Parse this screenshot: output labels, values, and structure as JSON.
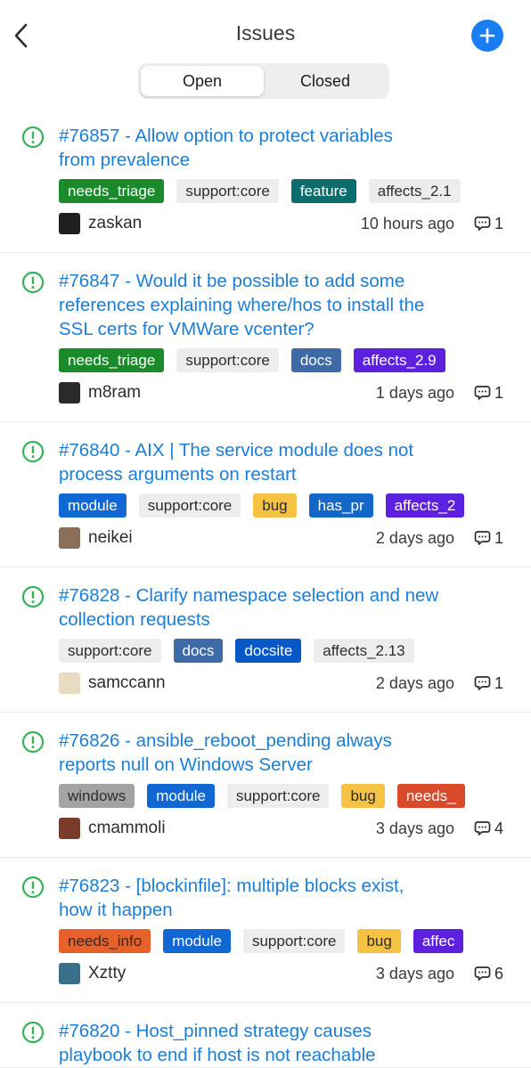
{
  "header": {
    "title": "Issues",
    "back_icon": "chevron-left-icon",
    "add_icon": "plus-icon"
  },
  "segment": {
    "open": "Open",
    "closed": "Closed",
    "selected": "Open"
  },
  "colors": {
    "accent": "#1a7ef2",
    "link": "#1b7ed6",
    "open_icon": "#35b359",
    "label_needs_triage": "#1a8a2b",
    "label_support_core": "#ededed",
    "label_feature": "#0c6d6e",
    "label_affects": "#ebebeb",
    "label_docs": "#3c6ba6",
    "label_affects_purple": "#5d20de",
    "label_module": "#1168d3",
    "label_bug": "#f6c244",
    "label_has_pr": "#1368c7",
    "label_docsite": "#0758c6",
    "label_windows": "#a3a3a3",
    "label_needs_info": "#e6622a"
  },
  "issues": [
    {
      "title_line1": "#76857 - Allow option to protect variables",
      "title_line2": "from prevalence",
      "title_line3": "",
      "labels": [
        {
          "text": "needs_triage",
          "bg": "#1a8a2b",
          "fg": "#ffffff"
        },
        {
          "text": "support:core",
          "bg": "#ededed",
          "fg": "#2c2c2e"
        },
        {
          "text": "feature",
          "bg": "#0c6d6e",
          "fg": "#ffffff"
        },
        {
          "text": "affects_2.1",
          "bg": "#ededed",
          "fg": "#2c2c2e"
        }
      ],
      "user": "zaskan",
      "time": "10 hours ago",
      "comments": "1"
    },
    {
      "title_line1": "#76847 - Would it be possible to add some",
      "title_line2": "references explaining where/hos to install the",
      "title_line3": "SSL certs for VMWare vcenter?",
      "labels": [
        {
          "text": "needs_triage",
          "bg": "#1a8a2b",
          "fg": "#ffffff"
        },
        {
          "text": "support:core",
          "bg": "#ededed",
          "fg": "#2c2c2e"
        },
        {
          "text": "docs",
          "bg": "#3c6ba6",
          "fg": "#ffffff"
        },
        {
          "text": "affects_2.9",
          "bg": "#5d20de",
          "fg": "#ffffff"
        }
      ],
      "user": "m8ram",
      "time": "1 days ago",
      "comments": "1"
    },
    {
      "title_line1": "#76840 - AIX | The service module does not",
      "title_line2": "process arguments on restart",
      "title_line3": "",
      "labels": [
        {
          "text": "module",
          "bg": "#1168d3",
          "fg": "#ffffff"
        },
        {
          "text": "support:core",
          "bg": "#ededed",
          "fg": "#2c2c2e"
        },
        {
          "text": "bug",
          "bg": "#f6c244",
          "fg": "#2c2c2e"
        },
        {
          "text": "has_pr",
          "bg": "#1368c7",
          "fg": "#ffffff"
        },
        {
          "text": "affects_2",
          "bg": "#5d20de",
          "fg": "#ffffff"
        }
      ],
      "user": "neikei",
      "time": "2 days ago",
      "comments": "1"
    },
    {
      "title_line1": "#76828 - Clarify namespace selection and new",
      "title_line2": "collection requests",
      "title_line3": "",
      "labels": [
        {
          "text": "support:core",
          "bg": "#ededed",
          "fg": "#2c2c2e"
        },
        {
          "text": "docs",
          "bg": "#3c6ba6",
          "fg": "#ffffff"
        },
        {
          "text": "docsite",
          "bg": "#0758c6",
          "fg": "#ffffff"
        },
        {
          "text": "affects_2.13",
          "bg": "#ededed",
          "fg": "#2c2c2e"
        }
      ],
      "user": "samccann",
      "time": "2 days ago",
      "comments": "1"
    },
    {
      "title_line1": "#76826 - ansible_reboot_pending always",
      "title_line2": "reports null on Windows Server",
      "title_line3": "",
      "labels": [
        {
          "text": "windows",
          "bg": "#a3a3a3",
          "fg": "#2c2c2e"
        },
        {
          "text": "module",
          "bg": "#1168d3",
          "fg": "#ffffff"
        },
        {
          "text": "support:core",
          "bg": "#ededed",
          "fg": "#2c2c2e"
        },
        {
          "text": "bug",
          "bg": "#f6c244",
          "fg": "#2c2c2e"
        },
        {
          "text": "needs_",
          "bg": "#d94a2a",
          "fg": "#ffffff"
        }
      ],
      "user": "cmammoli",
      "time": "3 days ago",
      "comments": "4"
    },
    {
      "title_line1": "#76823 - [blockinfile]: multiple blocks exist,",
      "title_line2": "how it happen",
      "title_line3": "",
      "labels": [
        {
          "text": "needs_info",
          "bg": "#e6622a",
          "fg": "#2c2c2e"
        },
        {
          "text": "module",
          "bg": "#1168d3",
          "fg": "#ffffff"
        },
        {
          "text": "support:core",
          "bg": "#ededed",
          "fg": "#2c2c2e"
        },
        {
          "text": "bug",
          "bg": "#f6c244",
          "fg": "#2c2c2e"
        },
        {
          "text": "affec",
          "bg": "#5d20de",
          "fg": "#ffffff"
        }
      ],
      "user": "Xztty",
      "time": "3 days ago",
      "comments": "6"
    },
    {
      "title_line1": "#76820 - Host_pinned strategy causes",
      "title_line2": "playbook to end if host is not reachable",
      "title_line3": "",
      "labels": [],
      "user": "",
      "time": "",
      "comments": ""
    }
  ]
}
